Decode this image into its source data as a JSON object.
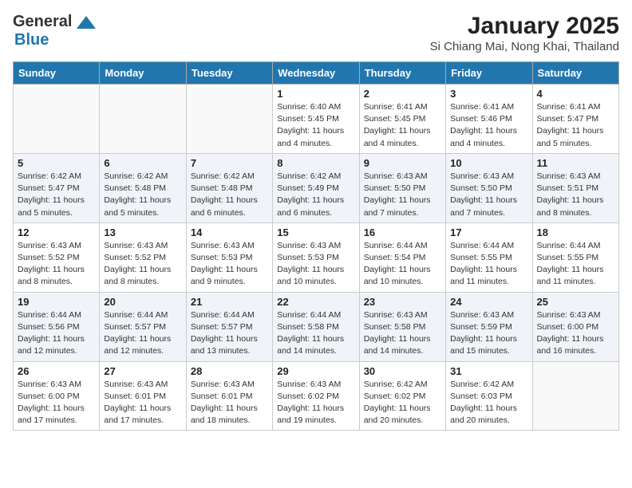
{
  "header": {
    "logo_general": "General",
    "logo_blue": "Blue",
    "title": "January 2025",
    "subtitle": "Si Chiang Mai, Nong Khai, Thailand"
  },
  "weekdays": [
    "Sunday",
    "Monday",
    "Tuesday",
    "Wednesday",
    "Thursday",
    "Friday",
    "Saturday"
  ],
  "weeks": [
    {
      "days": [
        {
          "num": "",
          "info": ""
        },
        {
          "num": "",
          "info": ""
        },
        {
          "num": "",
          "info": ""
        },
        {
          "num": "1",
          "info": "Sunrise: 6:40 AM\nSunset: 5:45 PM\nDaylight: 11 hours and 4 minutes."
        },
        {
          "num": "2",
          "info": "Sunrise: 6:41 AM\nSunset: 5:45 PM\nDaylight: 11 hours and 4 minutes."
        },
        {
          "num": "3",
          "info": "Sunrise: 6:41 AM\nSunset: 5:46 PM\nDaylight: 11 hours and 4 minutes."
        },
        {
          "num": "4",
          "info": "Sunrise: 6:41 AM\nSunset: 5:47 PM\nDaylight: 11 hours and 5 minutes."
        }
      ]
    },
    {
      "days": [
        {
          "num": "5",
          "info": "Sunrise: 6:42 AM\nSunset: 5:47 PM\nDaylight: 11 hours and 5 minutes."
        },
        {
          "num": "6",
          "info": "Sunrise: 6:42 AM\nSunset: 5:48 PM\nDaylight: 11 hours and 5 minutes."
        },
        {
          "num": "7",
          "info": "Sunrise: 6:42 AM\nSunset: 5:48 PM\nDaylight: 11 hours and 6 minutes."
        },
        {
          "num": "8",
          "info": "Sunrise: 6:42 AM\nSunset: 5:49 PM\nDaylight: 11 hours and 6 minutes."
        },
        {
          "num": "9",
          "info": "Sunrise: 6:43 AM\nSunset: 5:50 PM\nDaylight: 11 hours and 7 minutes."
        },
        {
          "num": "10",
          "info": "Sunrise: 6:43 AM\nSunset: 5:50 PM\nDaylight: 11 hours and 7 minutes."
        },
        {
          "num": "11",
          "info": "Sunrise: 6:43 AM\nSunset: 5:51 PM\nDaylight: 11 hours and 8 minutes."
        }
      ]
    },
    {
      "days": [
        {
          "num": "12",
          "info": "Sunrise: 6:43 AM\nSunset: 5:52 PM\nDaylight: 11 hours and 8 minutes."
        },
        {
          "num": "13",
          "info": "Sunrise: 6:43 AM\nSunset: 5:52 PM\nDaylight: 11 hours and 8 minutes."
        },
        {
          "num": "14",
          "info": "Sunrise: 6:43 AM\nSunset: 5:53 PM\nDaylight: 11 hours and 9 minutes."
        },
        {
          "num": "15",
          "info": "Sunrise: 6:43 AM\nSunset: 5:53 PM\nDaylight: 11 hours and 10 minutes."
        },
        {
          "num": "16",
          "info": "Sunrise: 6:44 AM\nSunset: 5:54 PM\nDaylight: 11 hours and 10 minutes."
        },
        {
          "num": "17",
          "info": "Sunrise: 6:44 AM\nSunset: 5:55 PM\nDaylight: 11 hours and 11 minutes."
        },
        {
          "num": "18",
          "info": "Sunrise: 6:44 AM\nSunset: 5:55 PM\nDaylight: 11 hours and 11 minutes."
        }
      ]
    },
    {
      "days": [
        {
          "num": "19",
          "info": "Sunrise: 6:44 AM\nSunset: 5:56 PM\nDaylight: 11 hours and 12 minutes."
        },
        {
          "num": "20",
          "info": "Sunrise: 6:44 AM\nSunset: 5:57 PM\nDaylight: 11 hours and 12 minutes."
        },
        {
          "num": "21",
          "info": "Sunrise: 6:44 AM\nSunset: 5:57 PM\nDaylight: 11 hours and 13 minutes."
        },
        {
          "num": "22",
          "info": "Sunrise: 6:44 AM\nSunset: 5:58 PM\nDaylight: 11 hours and 14 minutes."
        },
        {
          "num": "23",
          "info": "Sunrise: 6:43 AM\nSunset: 5:58 PM\nDaylight: 11 hours and 14 minutes."
        },
        {
          "num": "24",
          "info": "Sunrise: 6:43 AM\nSunset: 5:59 PM\nDaylight: 11 hours and 15 minutes."
        },
        {
          "num": "25",
          "info": "Sunrise: 6:43 AM\nSunset: 6:00 PM\nDaylight: 11 hours and 16 minutes."
        }
      ]
    },
    {
      "days": [
        {
          "num": "26",
          "info": "Sunrise: 6:43 AM\nSunset: 6:00 PM\nDaylight: 11 hours and 17 minutes."
        },
        {
          "num": "27",
          "info": "Sunrise: 6:43 AM\nSunset: 6:01 PM\nDaylight: 11 hours and 17 minutes."
        },
        {
          "num": "28",
          "info": "Sunrise: 6:43 AM\nSunset: 6:01 PM\nDaylight: 11 hours and 18 minutes."
        },
        {
          "num": "29",
          "info": "Sunrise: 6:43 AM\nSunset: 6:02 PM\nDaylight: 11 hours and 19 minutes."
        },
        {
          "num": "30",
          "info": "Sunrise: 6:42 AM\nSunset: 6:02 PM\nDaylight: 11 hours and 20 minutes."
        },
        {
          "num": "31",
          "info": "Sunrise: 6:42 AM\nSunset: 6:03 PM\nDaylight: 11 hours and 20 minutes."
        },
        {
          "num": "",
          "info": ""
        }
      ]
    }
  ]
}
